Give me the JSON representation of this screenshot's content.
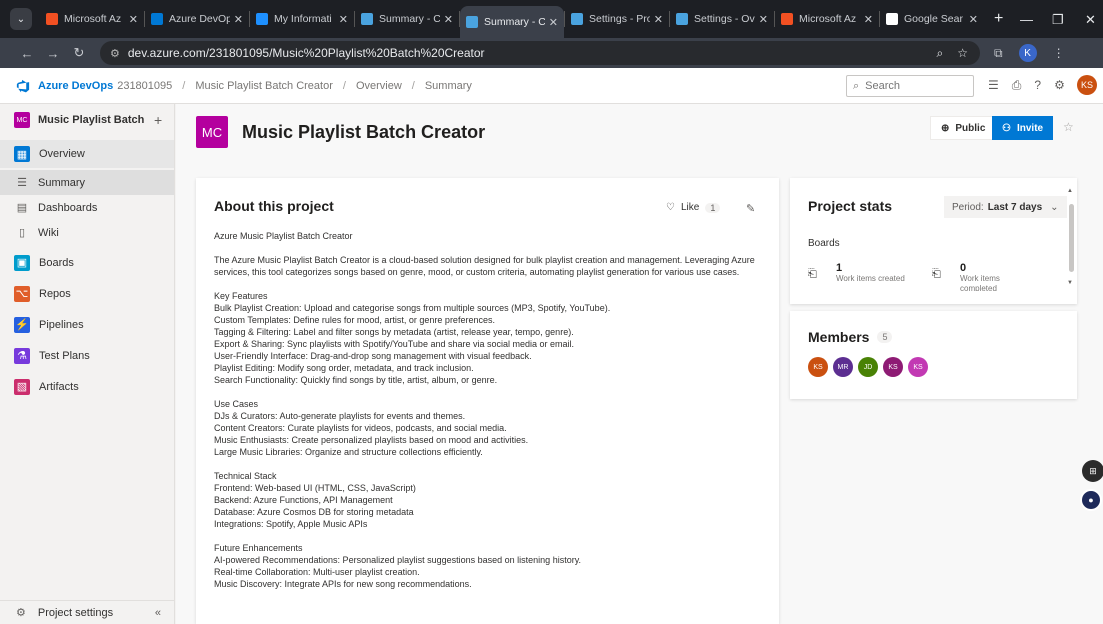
{
  "browser": {
    "tabs": [
      {
        "label": "Microsoft Az",
        "color": "#f25022",
        "active": false
      },
      {
        "label": "Azure DevOp",
        "color": "#0078d4",
        "active": false
      },
      {
        "label": "My Informati",
        "color": "#1e90ff",
        "active": false
      },
      {
        "label": "Summary - C",
        "color": "#4aa3df",
        "active": false
      },
      {
        "label": "Summary - C",
        "color": "#4aa3df",
        "active": true
      },
      {
        "label": "Settings - Pro",
        "color": "#4aa3df",
        "active": false
      },
      {
        "label": "Settings - Ov",
        "color": "#4aa3df",
        "active": false
      },
      {
        "label": "Microsoft Az",
        "color": "#f25022",
        "active": false
      },
      {
        "label": "Google Sear",
        "color": "#ffffff",
        "active": false
      }
    ],
    "url": "dev.azure.com/231801095/Music%20Playlist%20Batch%20Creator",
    "profile_initial": "K"
  },
  "header": {
    "brand": "Azure DevOps",
    "org": "231801095",
    "breadcrumbs": [
      "Music Playlist Batch Creator",
      "Overview",
      "Summary"
    ],
    "search_placeholder": "Search",
    "user_initials": "KS"
  },
  "sidebar": {
    "project_badge": "MC",
    "project_name": "Music Playlist Batch Cr...",
    "items": [
      {
        "label": "Overview",
        "icon": "overview-icon",
        "color": "#0078d4"
      },
      {
        "label": "Summary",
        "icon": "summary-icon",
        "sub": true
      },
      {
        "label": "Dashboards",
        "icon": "dashboards-icon",
        "sub": true
      },
      {
        "label": "Wiki",
        "icon": "wiki-icon",
        "sub": true
      },
      {
        "label": "Boards",
        "icon": "boards-icon",
        "color": "#009ccc"
      },
      {
        "label": "Repos",
        "icon": "repos-icon",
        "color": "#e05e2a"
      },
      {
        "label": "Pipelines",
        "icon": "pipelines-icon",
        "color": "#2560e0"
      },
      {
        "label": "Test Plans",
        "icon": "test-plans-icon",
        "color": "#773adc"
      },
      {
        "label": "Artifacts",
        "icon": "artifacts-icon",
        "color": "#cb2e6d"
      }
    ],
    "settings_label": "Project settings"
  },
  "page": {
    "badge": "MC",
    "title": "Music Playlist Batch Creator",
    "public_label": "Public",
    "invite_label": "Invite"
  },
  "about": {
    "heading": "About this project",
    "like_label": "Like",
    "like_count": "1",
    "paragraphs": [
      [
        "Azure Music Playlist Batch Creator"
      ],
      [
        "The Azure Music Playlist Batch Creator is a cloud-based solution designed for bulk playlist creation and management. Leveraging Azure",
        "services, this tool categorizes songs based on genre, mood, or custom criteria, automating playlist generation for various use cases."
      ],
      [
        "Key Features",
        "Bulk Playlist Creation: Upload and categorise songs from multiple sources (MP3, Spotify, YouTube).",
        "Custom Templates: Define rules for mood, artist, or genre preferences.",
        "Tagging & Filtering: Label and filter songs by metadata (artist, release year, tempo, genre).",
        "Export & Sharing: Sync playlists with Spotify/YouTube and share via social media or email.",
        "User-Friendly Interface: Drag-and-drop song management with visual feedback.",
        "Playlist Editing: Modify song order, metadata, and track inclusion.",
        "Search Functionality: Quickly find songs by title, artist, album, or genre."
      ],
      [
        "Use Cases",
        "DJs & Curators: Auto-generate playlists for events and themes.",
        "Content Creators: Curate playlists for videos, podcasts, and social media.",
        "Music Enthusiasts: Create personalized playlists based on mood and activities.",
        "Large Music Libraries: Organize and structure collections efficiently."
      ],
      [
        "Technical Stack",
        "Frontend: Web-based UI (HTML, CSS, JavaScript)",
        "Backend: Azure Functions, API Management",
        "Database: Azure Cosmos DB for storing metadata",
        "Integrations: Spotify, Apple Music APIs"
      ],
      [
        "Future Enhancements",
        "AI-powered Recommendations: Personalized playlist suggestions based on listening history.",
        "Real-time Collaboration: Multi-user playlist creation.",
        "Music Discovery: Integrate APIs for new song recommendations."
      ]
    ]
  },
  "stats": {
    "heading": "Project stats",
    "period_prefix": "Period:",
    "period_value": "Last 7 days",
    "section": "Boards",
    "items": [
      {
        "value": "1",
        "label": "Work items created"
      },
      {
        "value": "0",
        "label": "Work items completed"
      }
    ]
  },
  "members": {
    "heading": "Members",
    "count": "5",
    "avatars": [
      {
        "initials": "KS",
        "color": "#ca5010"
      },
      {
        "initials": "MR",
        "color": "#5c2e91"
      },
      {
        "initials": "JD",
        "color": "#498205"
      },
      {
        "initials": "KS",
        "color": "#8e1b74"
      },
      {
        "initials": "KS",
        "color": "#c239b3"
      }
    ]
  }
}
